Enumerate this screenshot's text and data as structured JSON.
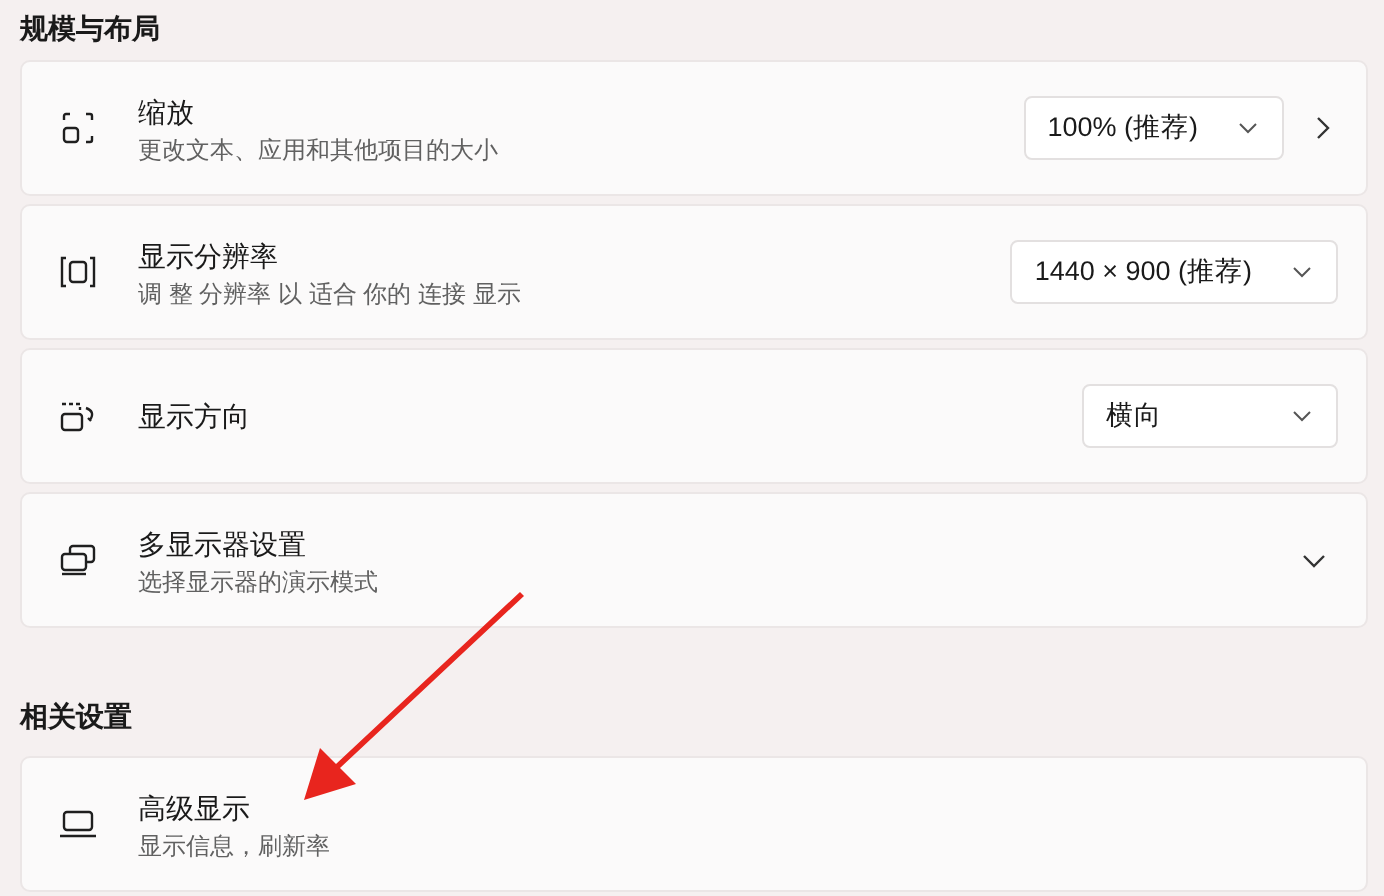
{
  "sections": [
    {
      "title": "规模与布局",
      "items": [
        {
          "kind": "dropdown_link",
          "title": "缩放",
          "subtitle": "更改文本、应用和其他项目的大小",
          "value": "100% (推荐)"
        },
        {
          "kind": "dropdown",
          "title": "显示分辨率",
          "subtitle": "调 整 分辨率 以 适合 你的 连接 显示",
          "value": "1440 × 900 (推荐)"
        },
        {
          "kind": "dropdown",
          "title": "显示方向",
          "value": "横向"
        },
        {
          "kind": "expander",
          "title": "多显示器设置",
          "subtitle": "选择显示器的演示模式",
          "expanded": false
        }
      ]
    },
    {
      "title": "相关设置",
      "items": [
        {
          "kind": "plain",
          "title": "高级显示",
          "subtitle": "显示信息，刷新率"
        }
      ]
    }
  ]
}
